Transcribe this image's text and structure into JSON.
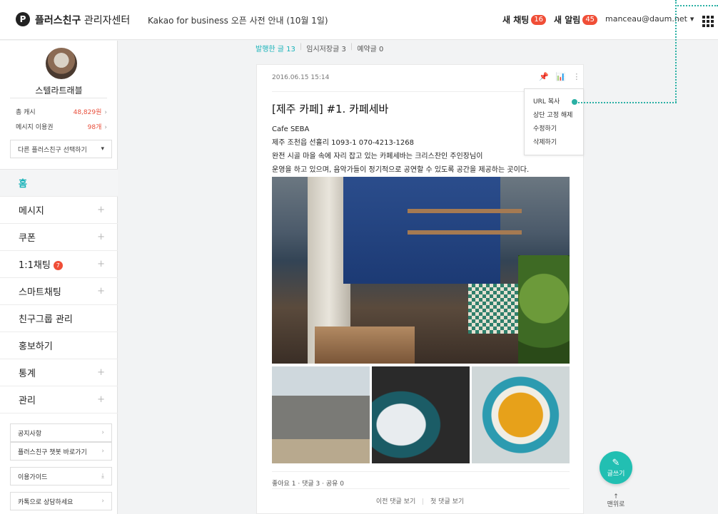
{
  "header": {
    "logo_glyph": "P",
    "brand_bold": "플러스친구",
    "brand_rest": "관리자센터",
    "notice": "Kakao for business 오픈 사전 안내 (10월 1일)",
    "new_chat_label": "새 채팅",
    "new_chat_count": "16",
    "new_alarm_label": "새 알림",
    "new_alarm_count": "45",
    "account_email": "manceau@daum.net",
    "account_caret": "▾"
  },
  "sidebar": {
    "profile_name": "스텔라트래블",
    "cash_label": "총 캐시",
    "cash_value": "48,829원",
    "voucher_label": "메시지 이용권",
    "voucher_value": "98개",
    "chevron": "›",
    "select_placeholder": "다른 플러스친구 선택하기",
    "select_caret": "▾",
    "nav": [
      {
        "label": "홈"
      },
      {
        "label": "메시지"
      },
      {
        "label": "쿠폰"
      },
      {
        "label": "1:1채팅",
        "badge": "7"
      },
      {
        "label": "스마트채팅"
      },
      {
        "label": "친구그룹 관리"
      },
      {
        "label": "홍보하기"
      },
      {
        "label": "통계"
      },
      {
        "label": "관리"
      }
    ],
    "plus_glyph": "+",
    "links": [
      {
        "label": "공지사항"
      },
      {
        "label": "플러스친구 챗봇 바로가기"
      },
      {
        "label": "이용가이드"
      },
      {
        "label": "카톡으로 상담하세요"
      }
    ],
    "download_glyph": "⤓"
  },
  "tabs": {
    "published": "발행한 글 13",
    "drafts": "임시저장글 3",
    "scheduled": "예약글 0",
    "separator": "|"
  },
  "post": {
    "date": "2016.06.15 15:14",
    "pin_glyph": "📌",
    "stats_glyph": "📊",
    "more_glyph": "⋮",
    "title": "[제주 카페] #1. 카페세바",
    "body": [
      "Cafe SEBA",
      "제주 조천읍 선흘리 1093-1  070-4213-1268",
      "완전 시골 마을 속에 자리 잡고 있는 카페세바는 크리스찬인 주인장님이",
      "운영을 하고 있으며, 음악가들이 정기적으로 공연할 수 있도록 공간을 제공하는 곳이다."
    ],
    "likes": "좋아요 1",
    "comments": "댓글 3",
    "shares": "공유 0",
    "dot_separator": "·",
    "prev_comments": "이전 댓글 보기",
    "first_comment": "첫 댓글 보기",
    "comment_separator": "|"
  },
  "menu": {
    "items": [
      "URL 복사",
      "상단 고정 해제",
      "수정하기",
      "삭제하기"
    ]
  },
  "floating": {
    "pen_glyph": "✎",
    "write_label": "글쓰기",
    "up_glyph": "↑",
    "top_label": "맨위로"
  },
  "colors": {
    "accent": "#17b2b8",
    "badge": "#f04e37",
    "write_button": "#22bfb2"
  }
}
